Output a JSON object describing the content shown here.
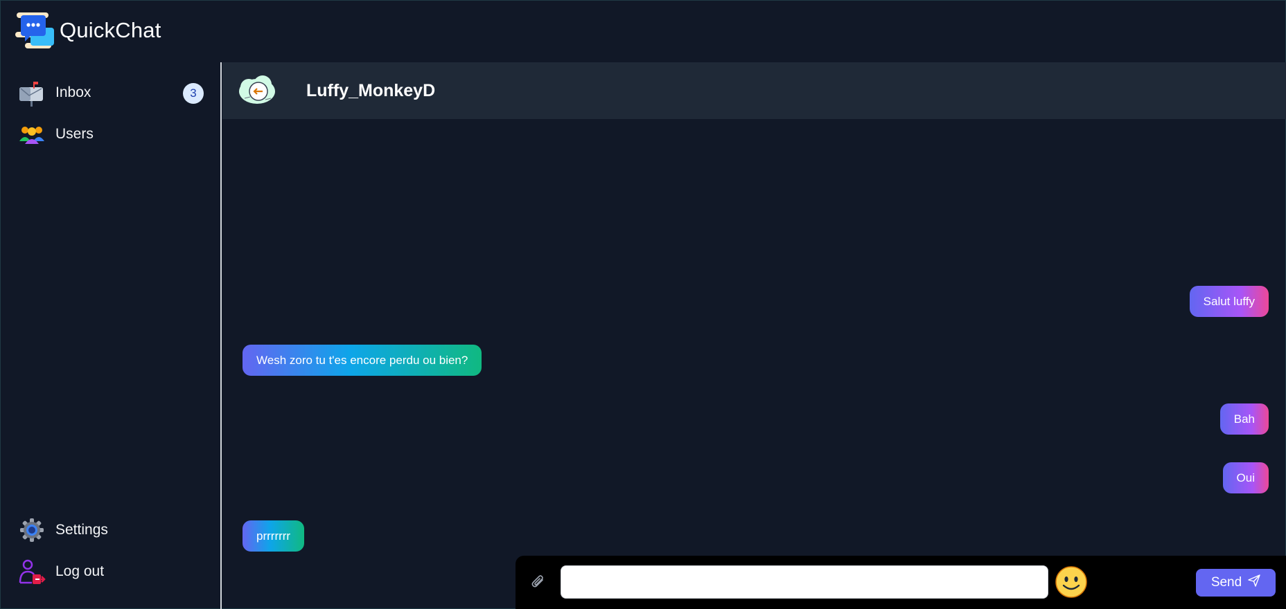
{
  "app": {
    "name": "QuickChat"
  },
  "sidebar": {
    "inbox": {
      "label": "Inbox",
      "badge": "3",
      "icon": "mailbox-icon"
    },
    "users": {
      "label": "Users",
      "icon": "users-icon"
    },
    "settings": {
      "label": "Settings",
      "icon": "gear-icon"
    },
    "logout": {
      "label": "Log out",
      "icon": "logout-icon"
    }
  },
  "chat": {
    "title": "Luffy_MonkeyD",
    "avatar_icon": "cloud-avatar-icon",
    "messages": [
      {
        "text": "Salut luffy",
        "direction": "sent"
      },
      {
        "text": "Wesh zoro tu t'es encore perdu ou bien?",
        "direction": "received"
      },
      {
        "text": "Bah",
        "direction": "sent"
      },
      {
        "text": "Oui",
        "direction": "sent"
      },
      {
        "text": "prrrrrrr",
        "direction": "received"
      }
    ]
  },
  "composer": {
    "value": "",
    "placeholder": "",
    "send_label": "Send",
    "attach_icon": "paperclip-icon",
    "emoji_icon": "smiley-icon",
    "send_icon": "paper-plane-icon"
  },
  "colors": {
    "background": "#111827",
    "header_bg": "#1f2937",
    "accent": "#6366f1",
    "sent_gradient_end": "#ec4899",
    "received_gradient_end": "#10b981",
    "badge_bg": "#dbeafe"
  }
}
